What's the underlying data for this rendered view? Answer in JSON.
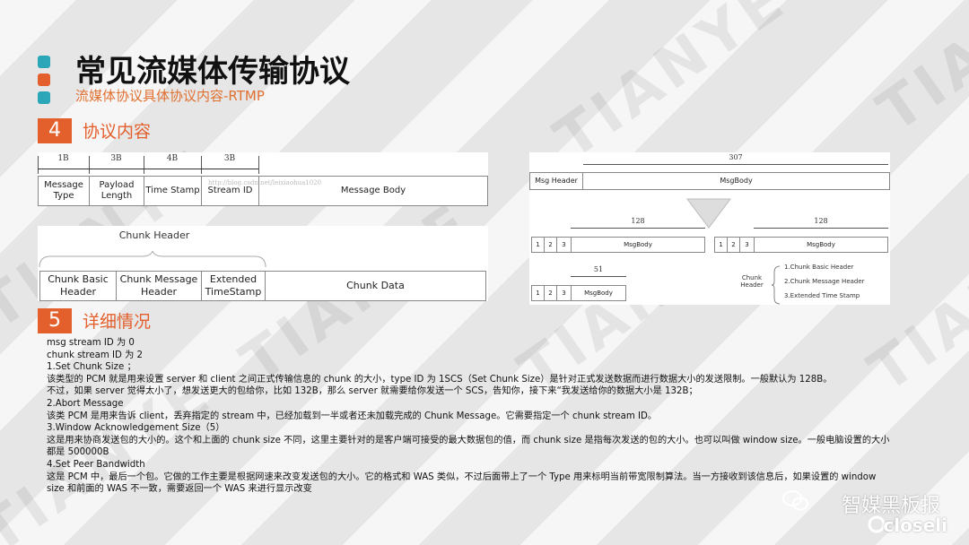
{
  "watermark": "TIANYE",
  "title": "常见流媒体传输协议",
  "subtitle": "流媒体协议具体协议内容-RTMP",
  "colors": {
    "accent_teal": "#2aa6b8",
    "accent_orange": "#e35f2c"
  },
  "section4": {
    "num": "4",
    "title": "协议内容"
  },
  "section5": {
    "num": "5",
    "title": "详细情况"
  },
  "msg_diagram": {
    "sizes": [
      "1B",
      "3B",
      "4B",
      "3B"
    ],
    "fields": [
      "Message\nType",
      "Payload\nLength",
      "Time Stamp",
      "Stream ID",
      "Message Body"
    ],
    "url": "http://blog.csdn.net/leixiaohua1020"
  },
  "chunk_diagram": {
    "header_label": "Chunk Header",
    "fields": [
      "Chunk Basic\nHeader",
      "Chunk Message\nHeader",
      "Extended\nTimeStamp",
      "Chunk Data"
    ]
  },
  "right_diagram": {
    "total": "307",
    "msg_header": "Msg Header",
    "msg_body": "MsgBody",
    "chunk1_size": "128",
    "chunk2_size": "128",
    "chunk3_size": "51",
    "idx": [
      "1",
      "2",
      "3"
    ],
    "chunk_header_label": "Chunk\nHeader",
    "legend": [
      "1.Chunk Basic Header",
      "2.Chunk Message Header",
      "3.Extended Time Stamp"
    ]
  },
  "details": [
    "msg stream ID 为 0",
    "chunk stream ID 为 2",
    "1.Set Chunk Size ；",
    "该类型的 PCM 就是用来设置 server 和 client 之间正式传输信息的 chunk 的大小，type ID 为 1SCS（Set Chunk Size）是针对正式发送数据而进行数据大小的发送限制。一般默认为 128B。",
    "不过，如果 server 觉得太小了，想发送更大的包给你，比如 132B，那么 server 就需要给你发送一个 SCS，告知你，接下来“我发送给你的数据大小是 132B；",
    "2.Abort Message",
    "该类 PCM 是用来告诉 client，丢弃指定的 stream 中，已经加载到一半或者还未加载完成的 Chunk Message。它需要指定一个 chunk stream ID。",
    "3.Window Acknowledgement Size（5）",
    "这是用来协商发送包的大小的。这个和上面的 chunk size 不同，这里主要针对的是客户端可接受的最大数据包的值，而 chunk size 是指每次发送的包的大小。也可以叫做 window size。一般电脑设置的大小都是 500000B",
    "4.Set Peer Bandwidth",
    "这是 PCM 中，最后一个包。它做的工作主要是根据网速来改变发送包的大小。它的格式和 WAS 类似，不过后面带上了一个 Type 用来标明当前带宽限制算法。当一方接收到该信息后，如果设置的 window size 和前面的 WAS 不一致，需要返回一个 WAS 来进行显示改变"
  ],
  "brand": {
    "name": "智媒黑板报",
    "logo_text": "closeli"
  }
}
